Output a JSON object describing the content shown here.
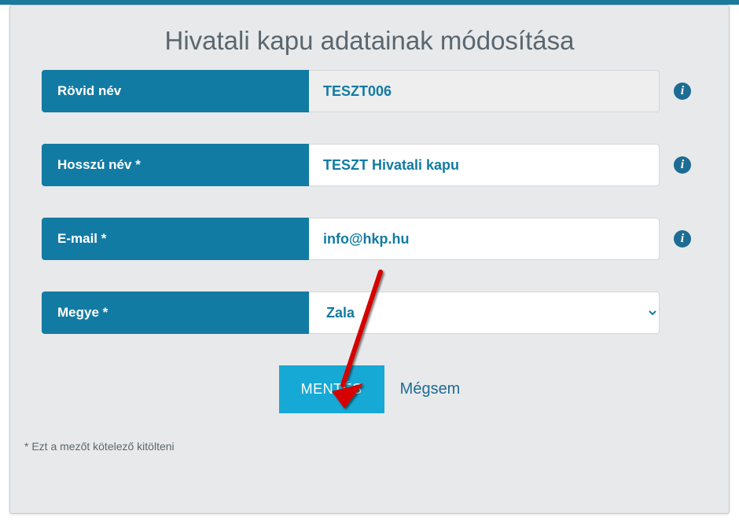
{
  "page_title": "Hivatali kapu adatainak módosítása",
  "fields": {
    "short_name": {
      "label": "Rövid név",
      "value": "TESZT006"
    },
    "long_name": {
      "label": "Hosszú név *",
      "value": "TESZT Hivatali kapu"
    },
    "email": {
      "label": "E-mail *",
      "value": "info@hkp.hu"
    },
    "county": {
      "label": "Megye *",
      "value": "Zala"
    }
  },
  "buttons": {
    "save": "MENTÉS",
    "cancel": "Mégsem"
  },
  "footnote": "* Ezt a mezőt kötelező kitölteni",
  "info_glyph": "i"
}
